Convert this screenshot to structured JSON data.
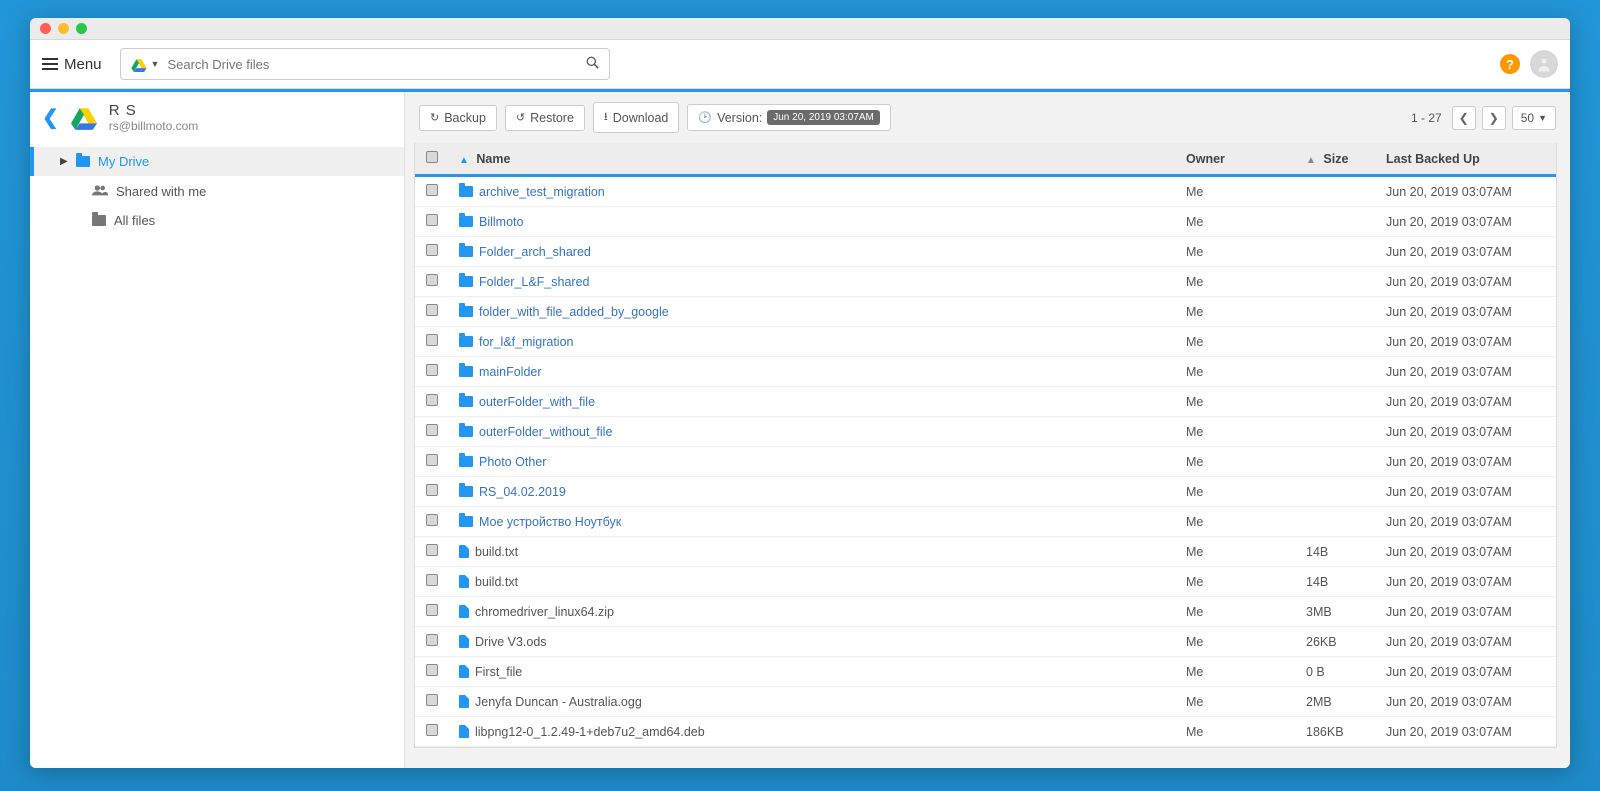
{
  "topbar": {
    "menu_label": "Menu",
    "search_placeholder": "Search Drive files"
  },
  "user": {
    "name": "R S",
    "email": "rs@billmoto.com"
  },
  "sidebar": {
    "my_drive": "My Drive",
    "shared": "Shared with me",
    "all_files": "All files"
  },
  "toolbar": {
    "backup": "Backup",
    "restore": "Restore",
    "download": "Download",
    "version_label": "Version:",
    "version_value": "Jun 20, 2019 03:07AM",
    "page_indicator": "1 - 27",
    "page_size": "50"
  },
  "columns": {
    "name": "Name",
    "owner": "Owner",
    "size": "Size",
    "backed": "Last Backed Up"
  },
  "rows": [
    {
      "type": "folder",
      "name": "archive_test_migration",
      "owner": "Me",
      "size": "",
      "date": "Jun 20, 2019 03:07AM"
    },
    {
      "type": "folder",
      "name": "Billmoto",
      "owner": "Me",
      "size": "",
      "date": "Jun 20, 2019 03:07AM"
    },
    {
      "type": "folder",
      "name": "Folder_arch_shared",
      "owner": "Me",
      "size": "",
      "date": "Jun 20, 2019 03:07AM"
    },
    {
      "type": "folder",
      "name": "Folder_L&F_shared",
      "owner": "Me",
      "size": "",
      "date": "Jun 20, 2019 03:07AM"
    },
    {
      "type": "folder",
      "name": "folder_with_file_added_by_google",
      "owner": "Me",
      "size": "",
      "date": "Jun 20, 2019 03:07AM"
    },
    {
      "type": "folder",
      "name": "for_l&f_migration",
      "owner": "Me",
      "size": "",
      "date": "Jun 20, 2019 03:07AM"
    },
    {
      "type": "folder",
      "name": "mainFolder",
      "owner": "Me",
      "size": "",
      "date": "Jun 20, 2019 03:07AM"
    },
    {
      "type": "folder",
      "name": "outerFolder_with_file",
      "owner": "Me",
      "size": "",
      "date": "Jun 20, 2019 03:07AM"
    },
    {
      "type": "folder",
      "name": "outerFolder_without_file",
      "owner": "Me",
      "size": "",
      "date": "Jun 20, 2019 03:07AM"
    },
    {
      "type": "folder",
      "name": "Photo Other",
      "owner": "Me",
      "size": "",
      "date": "Jun 20, 2019 03:07AM"
    },
    {
      "type": "folder",
      "name": "RS_04.02.2019",
      "owner": "Me",
      "size": "",
      "date": "Jun 20, 2019 03:07AM"
    },
    {
      "type": "folder",
      "name": "Мое устройство Ноутбук",
      "owner": "Me",
      "size": "",
      "date": "Jun 20, 2019 03:07AM"
    },
    {
      "type": "file",
      "name": "build.txt",
      "owner": "Me",
      "size": "14B",
      "date": "Jun 20, 2019 03:07AM"
    },
    {
      "type": "file",
      "name": "build.txt",
      "owner": "Me",
      "size": "14B",
      "date": "Jun 20, 2019 03:07AM"
    },
    {
      "type": "file",
      "name": "chromedriver_linux64.zip",
      "owner": "Me",
      "size": "3MB",
      "date": "Jun 20, 2019 03:07AM"
    },
    {
      "type": "file",
      "name": "Drive V3.ods",
      "owner": "Me",
      "size": "26KB",
      "date": "Jun 20, 2019 03:07AM"
    },
    {
      "type": "file",
      "name": "First_file",
      "owner": "Me",
      "size": "0 B",
      "date": "Jun 20, 2019 03:07AM"
    },
    {
      "type": "file",
      "name": "Jenyfa Duncan - Australia.ogg",
      "owner": "Me",
      "size": "2MB",
      "date": "Jun 20, 2019 03:07AM"
    },
    {
      "type": "file",
      "name": "libpng12-0_1.2.49-1+deb7u2_amd64.deb",
      "owner": "Me",
      "size": "186KB",
      "date": "Jun 20, 2019 03:07AM"
    }
  ]
}
